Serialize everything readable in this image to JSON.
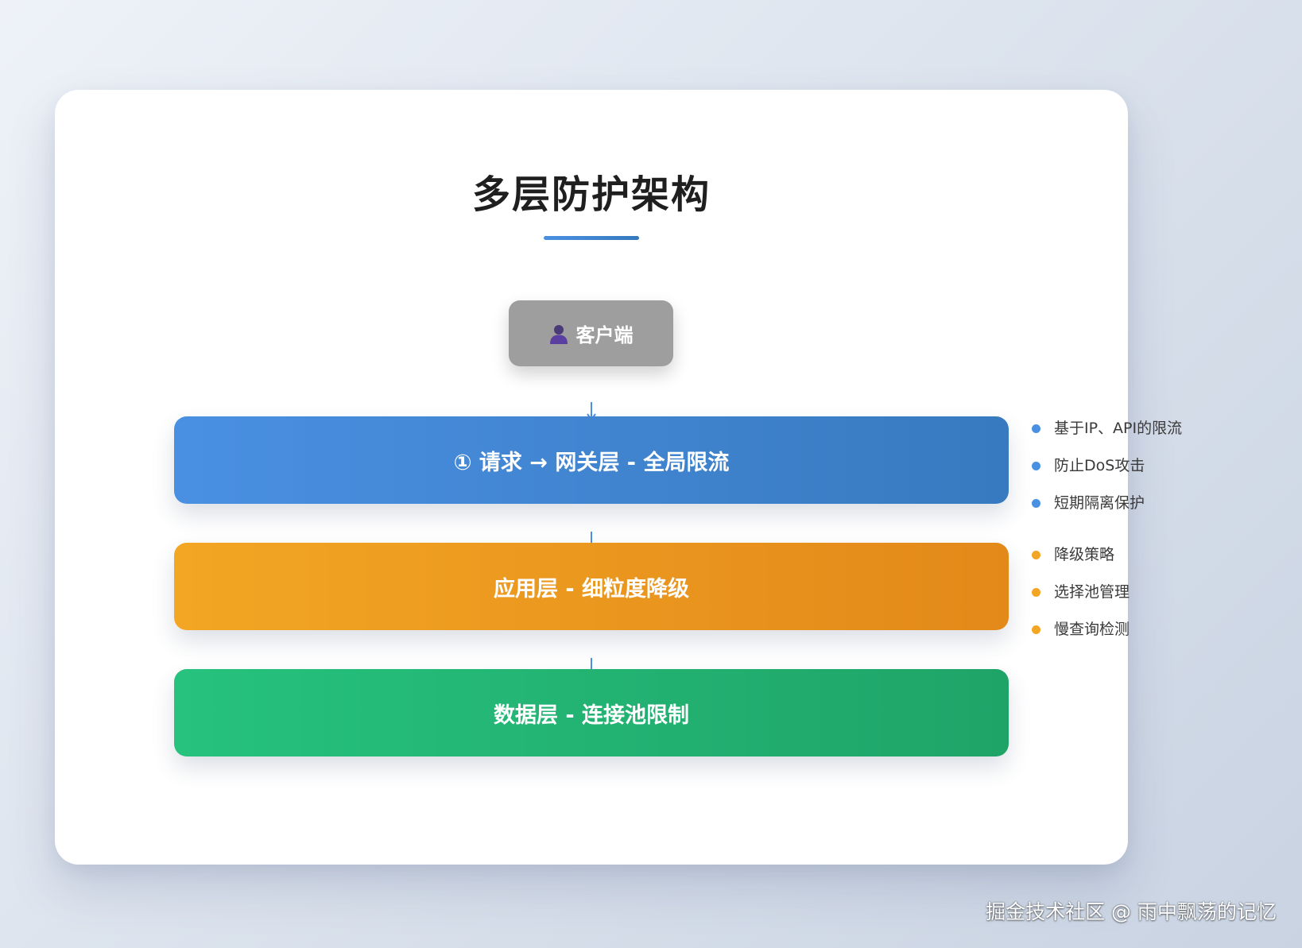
{
  "diagram": {
    "title": "多层防护架构",
    "client": {
      "icon": "person-icon",
      "label": "客户端"
    },
    "layers": [
      {
        "label": "① 请求 → 网关层 - 全局限流",
        "color": "#4a90e2",
        "bullets": [
          "基于IP、API的限流",
          "防止DoS攻击",
          "短期隔离保护"
        ]
      },
      {
        "label": "应用层 - 细粒度降级",
        "color": "#f2a623",
        "bullets": [
          "降级策略",
          "选择池管理",
          "慢查询检测"
        ]
      },
      {
        "label": "数据层 - 连接池限制",
        "color": "#26c27e",
        "bullets": []
      }
    ],
    "arrow_color": "#4a90e2"
  },
  "watermark": "掘金技术社区 @ 雨中飘荡的记忆"
}
